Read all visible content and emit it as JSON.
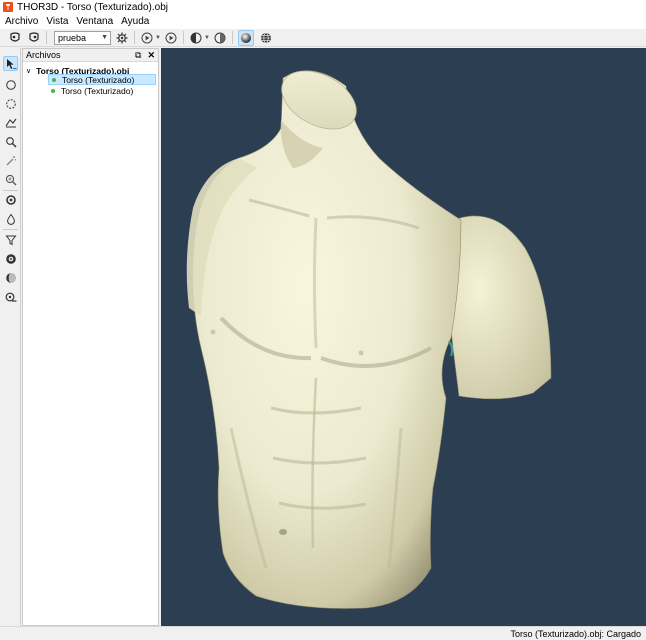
{
  "window": {
    "title": "THOR3D - Torso (Texturizado).obj"
  },
  "menu": {
    "items": [
      "Archivo",
      "Vista",
      "Ventana",
      "Ayuda"
    ]
  },
  "toolbar": {
    "profile_value": "prueba"
  },
  "files_panel": {
    "title": "Archivos",
    "root_label": "Torso (Texturizado).obj",
    "children": [
      "Torso (Texturizado)",
      "Torso (Texturizado)"
    ]
  },
  "status": {
    "text": "Torso (Texturizado).obj: Cargado"
  },
  "colors": {
    "viewport_bg": "#2c3e52",
    "model_surface": "#efeccb",
    "selection": "#cce8ff",
    "visible_dot": "#47b649"
  }
}
